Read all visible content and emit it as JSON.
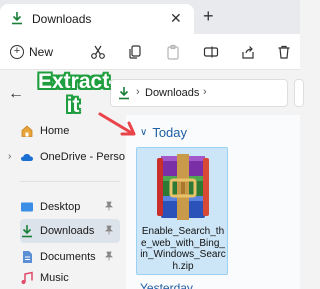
{
  "window": {
    "tab_label": "Downloads",
    "tab_close": "✕",
    "new_tab": "+"
  },
  "toolbar": {
    "new_label": "New",
    "icons": [
      "cut-icon",
      "copy-icon",
      "paste-icon",
      "rename-icon",
      "share-icon",
      "delete-icon"
    ]
  },
  "nav": {
    "back": "←",
    "address_sep": "›",
    "address_folder": "Downloads",
    "address_chevron": "›"
  },
  "sidebar": {
    "items": [
      {
        "label": "Home"
      },
      {
        "label": "OneDrive - Perso"
      },
      {
        "label": "Desktop"
      },
      {
        "label": "Downloads"
      },
      {
        "label": "Documents"
      },
      {
        "label": "Music"
      }
    ],
    "expand_chevron": "›"
  },
  "content": {
    "group_today": "Today",
    "group_chevron": "∨",
    "file_name": "Enable_Search_the_web_with_Bing_in_Windows_Search.zip",
    "group_yesterday": "Yesterday"
  },
  "annotation": {
    "text_line1": "Extract",
    "text_line2": "it"
  },
  "colors": {
    "accent": "#1f5fa3",
    "annotation_green": "#1e9e3e",
    "arrow_red": "#e8444a",
    "selection": "#cde6f7"
  }
}
